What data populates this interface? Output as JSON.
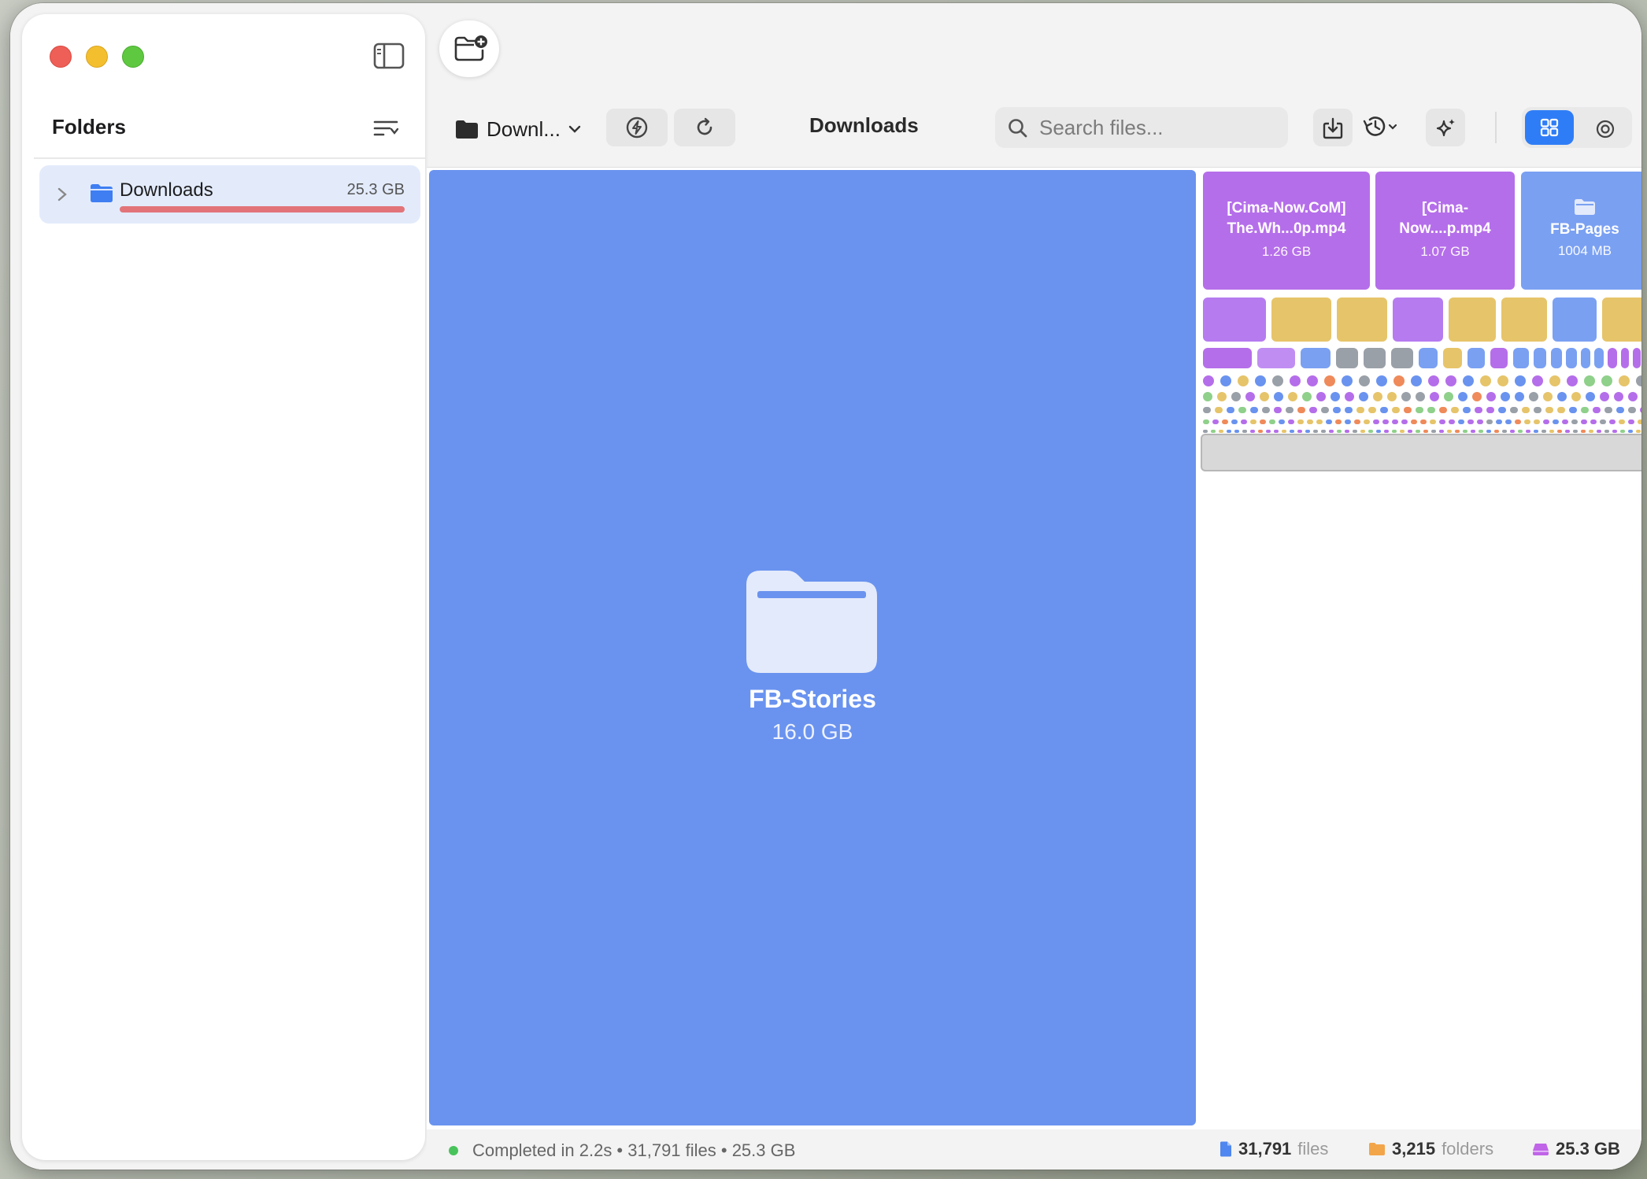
{
  "window": {
    "title": "Downloads"
  },
  "sidebar": {
    "title": "Folders",
    "items": [
      {
        "label": "Downloads",
        "size": "25.3 GB"
      }
    ]
  },
  "toolbar": {
    "path_label": "Downl...",
    "title": "Downloads",
    "search_placeholder": "Search files..."
  },
  "treemap": {
    "main": {
      "name": "FB-Stories",
      "size": "16.0 GB"
    },
    "tiles": [
      {
        "name": "[Cima-Now.CoM] The.Wh...0p.mp4",
        "line1": "[Cima-Now.CoM]",
        "line2": "The.Wh...0p.mp4",
        "size": "1.26 GB",
        "color": "#b56eea"
      },
      {
        "name": "[Cima-Now....p.mp4",
        "line1": "[Cima-",
        "line2": "Now....p.mp4",
        "size": "1.07 GB",
        "color": "#b56eea"
      },
      {
        "name": "FB-Pages",
        "size": "1004 MB",
        "color": "#6a93ef"
      }
    ],
    "colors": {
      "video": "#b56eea",
      "folder": "#6a93ef",
      "image": "#e6c46a",
      "other": "#9aa0a8",
      "orange": "#ef8a5a",
      "green": "#8fd08a"
    }
  },
  "status": {
    "text": "Completed in 2.2s • 31,791 files • 25.3 GB",
    "files_count": "31,791",
    "files_label": "files",
    "folders_count": "3,215",
    "folders_label": "folders",
    "total_size": "25.3 GB"
  }
}
